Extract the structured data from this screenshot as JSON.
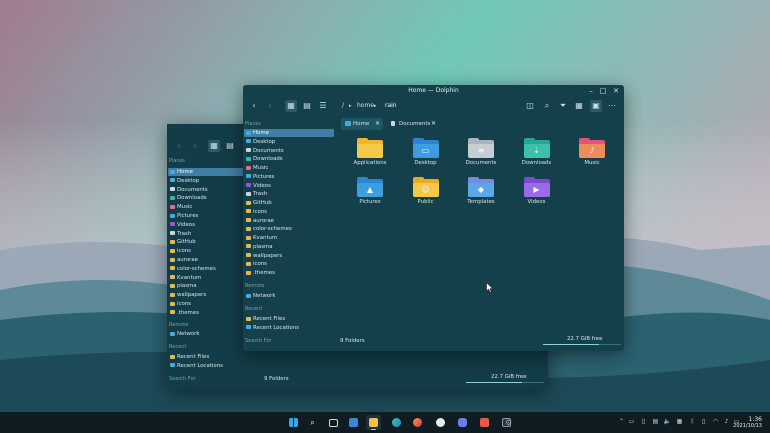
{
  "front_window": {
    "title": "Home — Dolphin",
    "breadcrumb": [
      "/",
      "home",
      "rain"
    ],
    "tabs": [
      {
        "label": "Home",
        "close": "✕"
      },
      {
        "label": "Documents",
        "close": "✕"
      }
    ],
    "places_heading": "Places",
    "places": [
      "Home",
      "Desktop",
      "Documents",
      "Downloads",
      "Music",
      "Pictures",
      "Videos",
      "Trash",
      "GitHub",
      "icons",
      "aurorae",
      "color-schemes",
      "Kvantum",
      "plasma",
      "wallpapers",
      "icons",
      ".themes"
    ],
    "remote_heading": "Remote",
    "remote": [
      "Network"
    ],
    "recent_heading": "Recent",
    "recent": [
      "Recent Files",
      "Recent Locations"
    ],
    "search_heading": "Search For",
    "files": [
      "Applications",
      "Desktop",
      "Documents",
      "Downloads",
      "Music",
      "Pictures",
      "Public",
      "Templates",
      "Videos"
    ],
    "status_left": "9 Folders",
    "status_right": "22.7 GiB free",
    "free_fraction": 0.72
  },
  "back_window": {
    "places_heading": "Places",
    "places": [
      "Home",
      "Desktop",
      "Documents",
      "Downloads",
      "Music",
      "Pictures",
      "Videos",
      "Trash",
      "GitHub",
      "icons",
      "aurorae",
      "color-schemes",
      "Kvantum",
      "plasma",
      "wallpapers",
      "icons",
      ".themes"
    ],
    "remote_heading": "Remote",
    "remote": [
      "Network"
    ],
    "recent_heading": "Recent",
    "recent": [
      "Recent Files",
      "Recent Locations"
    ],
    "search_heading": "Search For",
    "status_left": "9 Folders",
    "status_right": "22.7 GiB free",
    "free_fraction": 0.72
  },
  "clock": {
    "time": "1:36",
    "date": "2021/10/13"
  }
}
